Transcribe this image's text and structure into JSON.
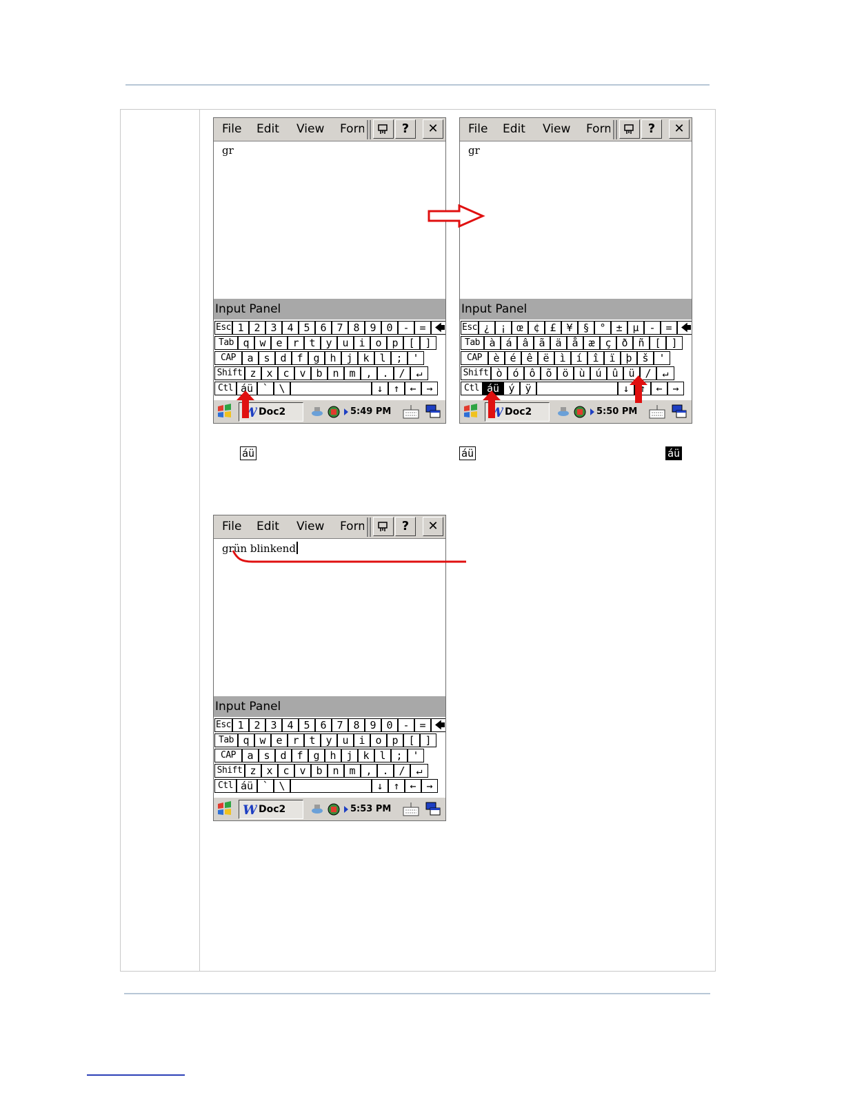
{
  "menu": {
    "file": "File",
    "edit": "Edit",
    "view": "View",
    "format": "Format",
    "help": "?",
    "close": "✕"
  },
  "screens": [
    {
      "text": "gr",
      "time": "5:49 PM",
      "doc": "Doc2",
      "panel": "Input Panel"
    },
    {
      "text": "gr",
      "time": "5:50 PM",
      "doc": "Doc2",
      "panel": "Input Panel"
    },
    {
      "text": "grün blinkend",
      "time": "5:53 PM",
      "doc": "Doc2",
      "panel": "Input Panel"
    }
  ],
  "keyboard_standard": [
    [
      "Esc",
      "1",
      "2",
      "3",
      "4",
      "5",
      "6",
      "7",
      "8",
      "9",
      "0",
      "-",
      "=",
      "🡄"
    ],
    [
      "Tab",
      "q",
      "w",
      "e",
      "r",
      "t",
      "y",
      "u",
      "i",
      "o",
      "p",
      "[",
      "]"
    ],
    [
      "CAP",
      "a",
      "s",
      "d",
      "f",
      "g",
      "h",
      "j",
      "k",
      "l",
      ";",
      "'"
    ],
    [
      "Shift",
      "z",
      "x",
      "c",
      "v",
      "b",
      "n",
      "m",
      ",",
      ".",
      "/",
      "↵"
    ],
    [
      "Ctl",
      "áü",
      "`",
      "\\",
      "",
      "↓",
      "↑",
      "←",
      "→"
    ]
  ],
  "keyboard_international": [
    [
      "Esc",
      "¿",
      "¡",
      "œ",
      "¢",
      "£",
      "¥",
      "§",
      "°",
      "±",
      "µ",
      "-",
      "=",
      "🡄"
    ],
    [
      "Tab",
      "à",
      "á",
      "â",
      "ã",
      "ä",
      "å",
      "æ",
      "ç",
      "ð",
      "ñ",
      "[",
      "]"
    ],
    [
      "CAP",
      "è",
      "é",
      "ê",
      "ë",
      "ì",
      "í",
      "î",
      "ï",
      "þ",
      "š",
      "'"
    ],
    [
      "Shift",
      "ò",
      "ó",
      "ô",
      "õ",
      "ö",
      "ù",
      "ú",
      "û",
      "ü",
      "/",
      "↵"
    ],
    [
      "Ctl",
      "áü",
      "ý",
      "ÿ",
      "",
      "↓",
      "↑",
      "←",
      "→"
    ]
  ],
  "captions": {
    "key_label_1": "áü",
    "key_label_2": "áü",
    "key_label_3": "áü"
  }
}
